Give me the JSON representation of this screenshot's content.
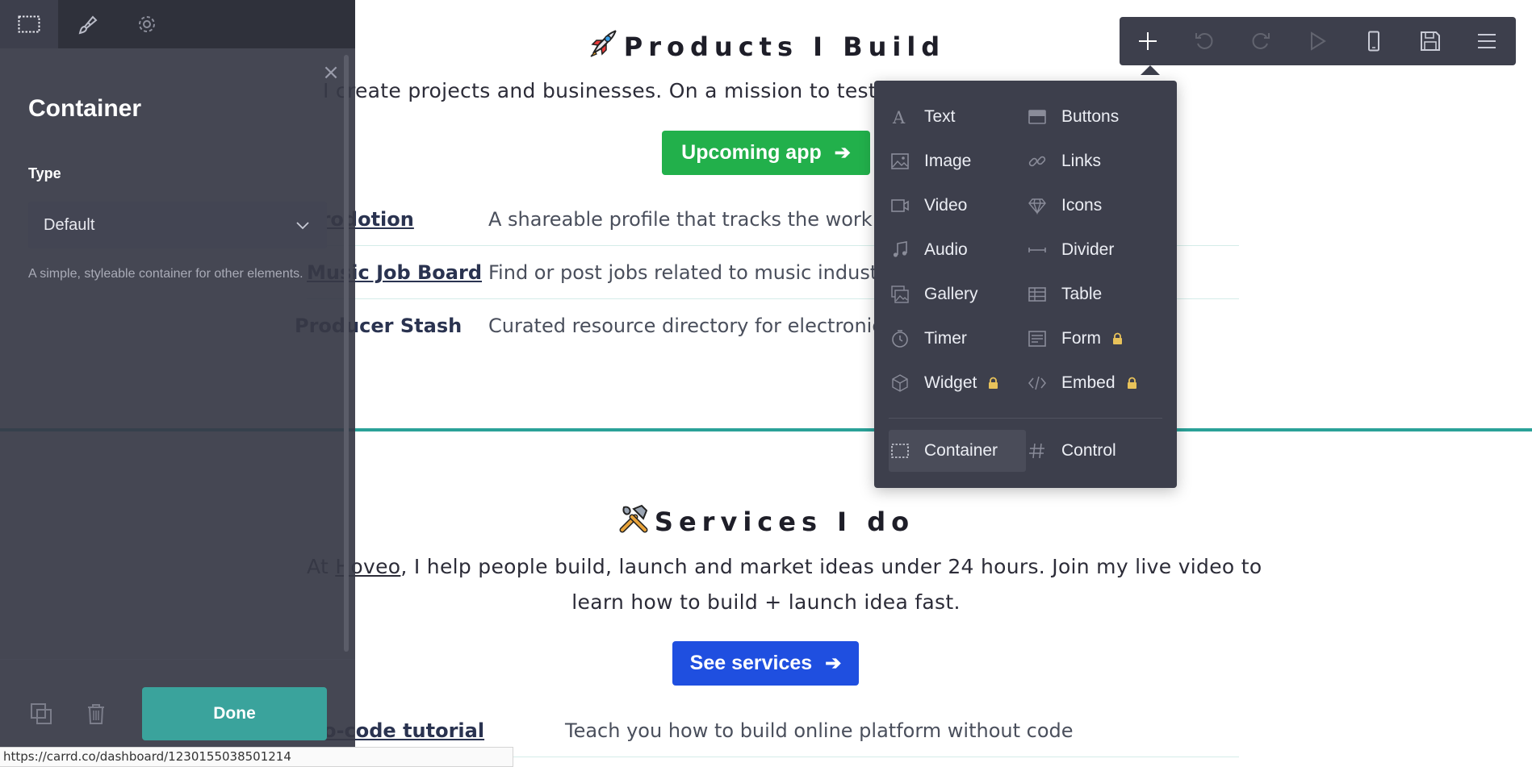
{
  "site": {
    "products": {
      "emoji": "🚀",
      "title": "Products I Build",
      "intro": "I create projects and businesses. On a mission to test New Edition, this year Fit.",
      "cta_label": "Upcoming app",
      "cta_color": "#22b04b",
      "rows": [
        {
          "name": "Prodotion",
          "desc": "A shareable profile that tracks the work you do"
        },
        {
          "name": "Music Job Board",
          "desc": "Find or post jobs related to music industry"
        },
        {
          "name": "Producer Stash",
          "desc": "Curated resource directory for electronic music producers"
        }
      ]
    },
    "services": {
      "emoji": "🛠️",
      "title": "Services I do",
      "intro_line1": "At Hoveo, I help people build, launch and market ideas under 24 hours. Join my live video to",
      "intro_link": "Hoveo",
      "intro_line2": "learn how to build + launch idea fast.",
      "cta_label": "See services",
      "cta_color": "#1f4fe0",
      "rows": [
        {
          "name": "No-code tutorial",
          "desc": "Teach you how to build online platform without code"
        }
      ]
    },
    "divider_color": "#2aa198"
  },
  "panel": {
    "tabs": [
      {
        "name": "container-tab",
        "icon": "dashed-square-icon"
      },
      {
        "name": "style-tab",
        "icon": "brush-icon"
      },
      {
        "name": "settings-tab",
        "icon": "gear-icon"
      }
    ],
    "title": "Container",
    "type_label": "Type",
    "type_value": "Default",
    "type_help": "A simple, styleable container for other elements.",
    "done_label": "Done",
    "done_color": "#3aa39c"
  },
  "toolbar": {
    "buttons": [
      "plus-icon",
      "undo-icon",
      "redo-icon",
      "play-icon",
      "mobile-icon",
      "save-icon",
      "menu-icon"
    ]
  },
  "add_menu": {
    "items": [
      {
        "label": "Text",
        "icon": "text-icon",
        "locked": false
      },
      {
        "label": "Buttons",
        "icon": "buttons-icon",
        "locked": false
      },
      {
        "label": "Image",
        "icon": "image-icon",
        "locked": false
      },
      {
        "label": "Links",
        "icon": "links-icon",
        "locked": false
      },
      {
        "label": "Video",
        "icon": "video-icon",
        "locked": false
      },
      {
        "label": "Icons",
        "icon": "diamond-icon",
        "locked": false
      },
      {
        "label": "Audio",
        "icon": "music-note-icon",
        "locked": false
      },
      {
        "label": "Divider",
        "icon": "divider-icon",
        "locked": false
      },
      {
        "label": "Gallery",
        "icon": "gallery-icon",
        "locked": false
      },
      {
        "label": "Table",
        "icon": "table-icon",
        "locked": false
      },
      {
        "label": "Timer",
        "icon": "clock-icon",
        "locked": false
      },
      {
        "label": "Form",
        "icon": "form-icon",
        "locked": true
      },
      {
        "label": "Widget",
        "icon": "cube-icon",
        "locked": true
      },
      {
        "label": "Embed",
        "icon": "code-icon",
        "locked": true
      }
    ],
    "bottom": [
      {
        "label": "Container",
        "icon": "dashed-square-icon",
        "selected": true
      },
      {
        "label": "Control",
        "icon": "hash-icon",
        "selected": false
      }
    ],
    "lock_color": "#e8c25a"
  },
  "status_url": "https://carrd.co/dashboard/1230155038501214"
}
